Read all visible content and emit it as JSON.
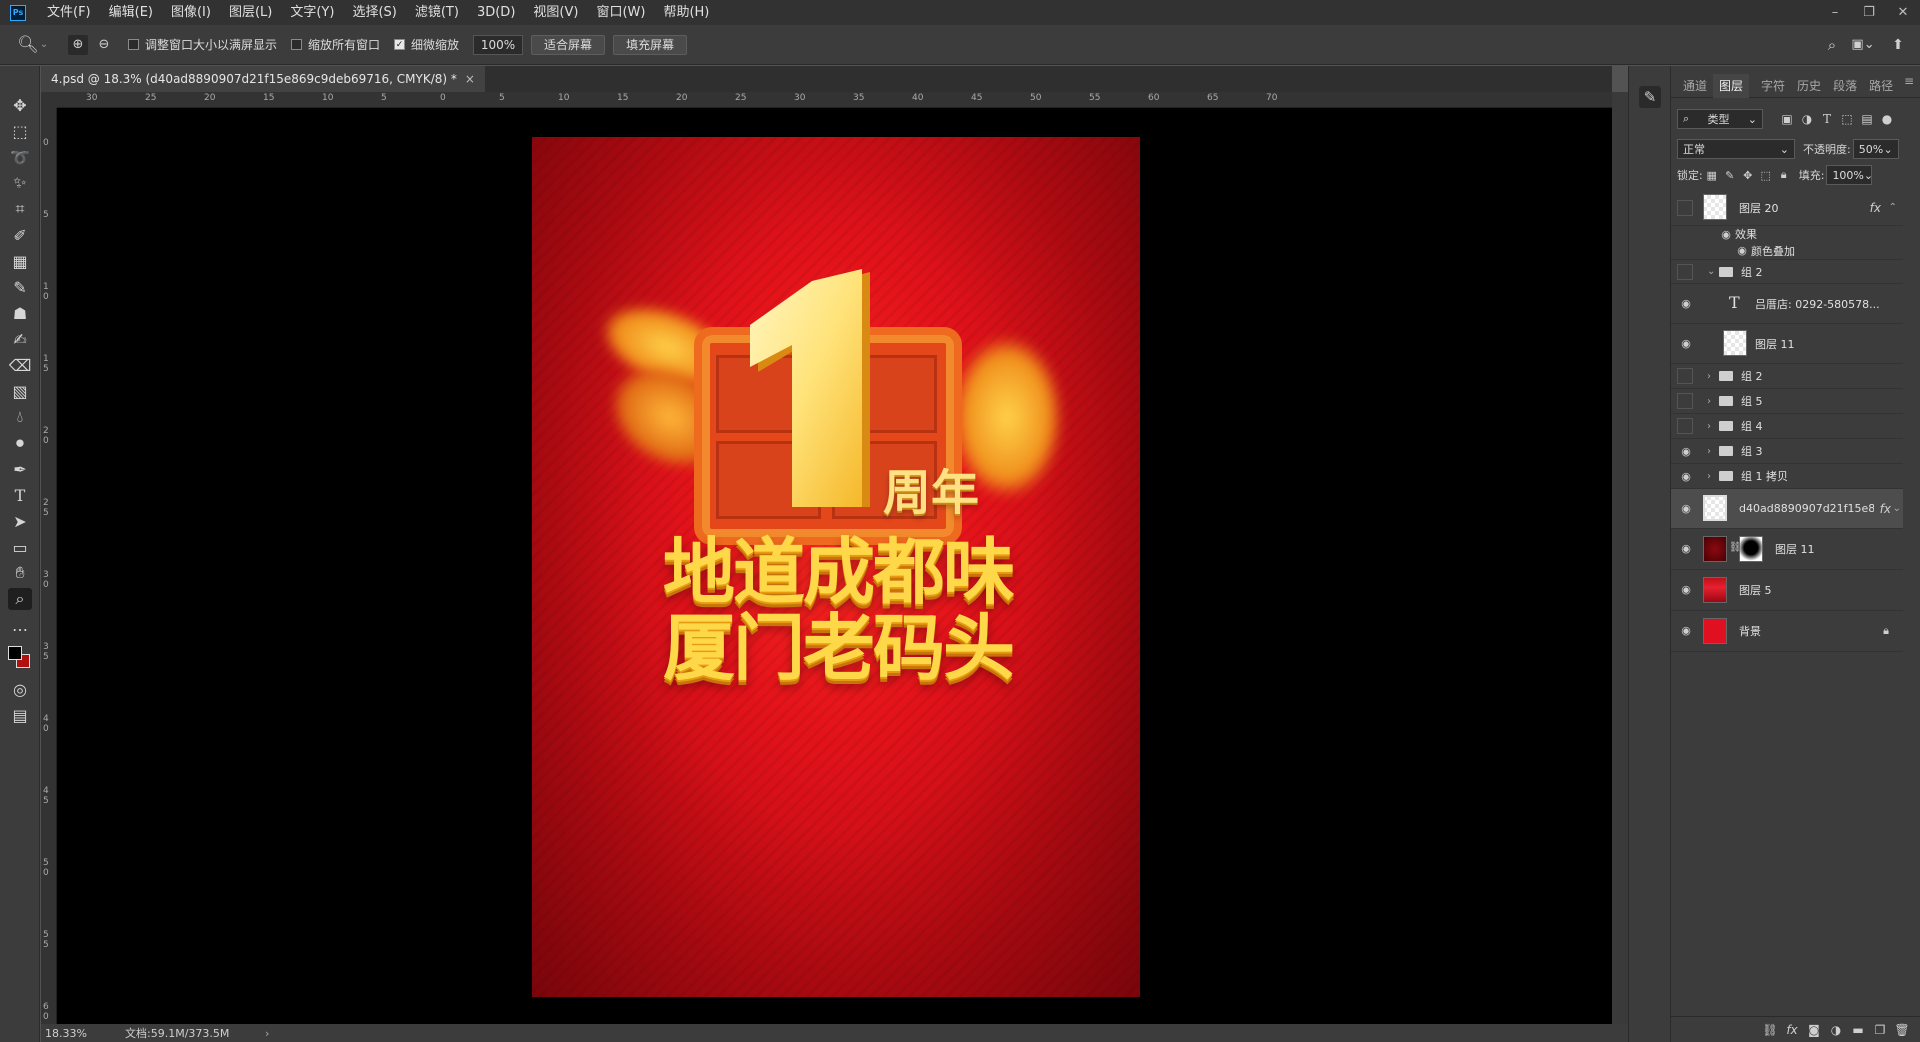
{
  "app": {
    "logo": "Ps"
  },
  "menu": [
    "文件(F)",
    "编辑(E)",
    "图像(I)",
    "图层(L)",
    "文字(Y)",
    "选择(S)",
    "滤镜(T)",
    "3D(D)",
    "视图(V)",
    "窗口(W)",
    "帮助(H)"
  ],
  "window_controls": {
    "minimize": "–",
    "restore": "❐",
    "close": "✕"
  },
  "options": {
    "resize_windows": "调整窗口大小以满屏显示",
    "zoom_all": "缩放所有窗口",
    "scrubby_zoom": "细微缩放",
    "zoom_value": "100%",
    "fit_screen": "适合屏幕",
    "fill_screen": "填充屏幕"
  },
  "document": {
    "tab_title": "4.psd @ 18.3% (d40ad8890907d21f15e869c9deb69716, CMYK/8) *",
    "close": "×",
    "ruler_top": [
      "30",
      "25",
      "20",
      "15",
      "10",
      "5",
      "0",
      "5",
      "10",
      "15",
      "20",
      "25",
      "30",
      "35",
      "40",
      "45",
      "50",
      "55",
      "60",
      "65",
      "70"
    ],
    "ruler_left": [
      "0",
      "5",
      "1 0",
      "1 5",
      "2 0",
      "2 5",
      "3 0",
      "3 5",
      "4 0",
      "4 5",
      "5 0",
      "5 5",
      "6 0"
    ]
  },
  "poster": {
    "number": "1",
    "anniversary": "周年",
    "line1": "地道成都味",
    "line2": "厦门老码头"
  },
  "status": {
    "zoom": "18.33%",
    "doc_size": "文档:59.1M/373.5M",
    "arrow": "›"
  },
  "panels": {
    "tabs": [
      "通道",
      "图层",
      "字符",
      "历史",
      "段落",
      "路径"
    ],
    "active_tab": "图层",
    "menu": "≡",
    "filter_kind": "类型",
    "blend_mode": "正常",
    "opacity_label": "不透明度:",
    "opacity_value": "50%",
    "lock_label": "锁定:",
    "fill_label": "填充:",
    "fill_value": "100%"
  },
  "layers": [
    {
      "name": "图层 20",
      "fx": "fx"
    },
    {
      "name": "效果"
    },
    {
      "name": "颜色叠加"
    },
    {
      "name": "组 2"
    },
    {
      "name": "吕厝店: 0292-580578..."
    },
    {
      "name": "图层 11"
    },
    {
      "name": "组 2"
    },
    {
      "name": "组 5"
    },
    {
      "name": "组 4"
    },
    {
      "name": "组 3"
    },
    {
      "name": "组 1 拷贝"
    },
    {
      "name": "d40ad8890907d21f15e8...",
      "fx": "fx"
    },
    {
      "name": "图层 11"
    },
    {
      "name": "图层 5"
    },
    {
      "name": "背景"
    }
  ],
  "colors": {
    "accent": "#31a8ff",
    "poster_red": "#e2121a",
    "poster_gold": "#ffd84a"
  }
}
